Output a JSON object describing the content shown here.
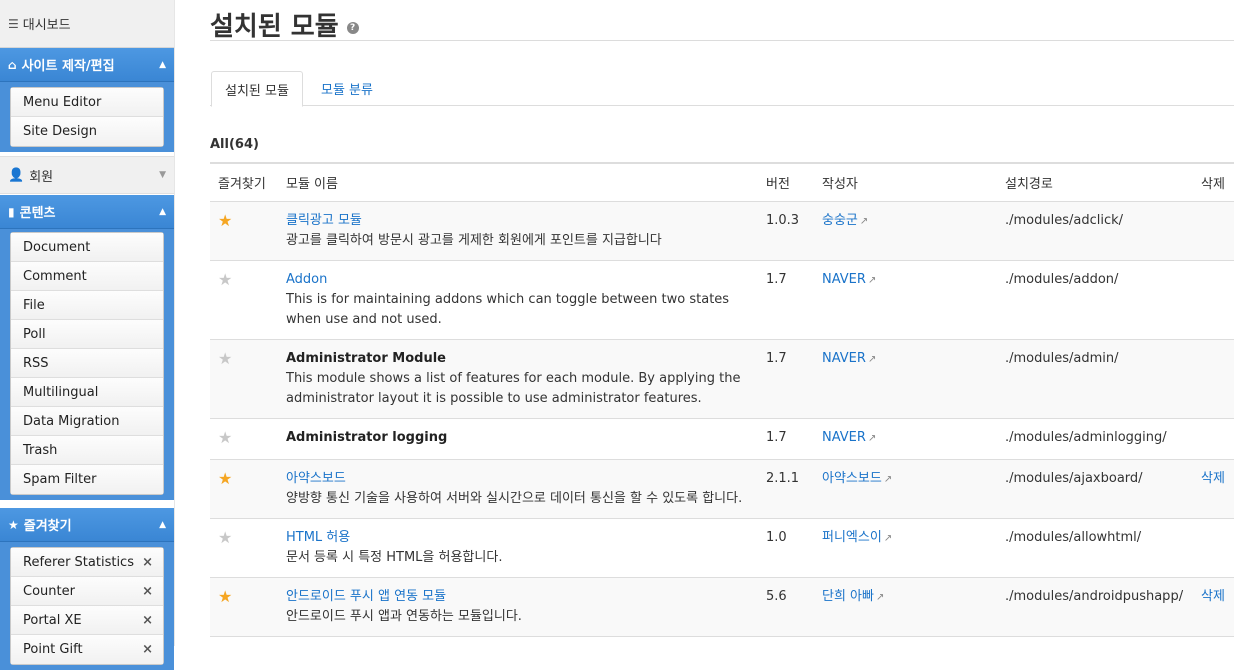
{
  "sidebar": {
    "dashboard": "대시보드",
    "site_group": {
      "title": "사이트 제작/편집",
      "items": [
        "Menu Editor",
        "Site Design"
      ]
    },
    "member_group": {
      "title": "회원"
    },
    "content_group": {
      "title": "콘텐츠",
      "items": [
        "Document",
        "Comment",
        "File",
        "Poll",
        "RSS",
        "Multilingual",
        "Data Migration",
        "Trash",
        "Spam Filter"
      ]
    },
    "fav_group": {
      "title": "즐겨찾기",
      "items": [
        "Referer Statistics",
        "Counter",
        "Portal XE",
        "Point Gift"
      ],
      "remove_symbol": "×"
    }
  },
  "page": {
    "title": "설치된 모듈",
    "help": "?",
    "tabs": [
      "설치된 모듈",
      "모듈 분류"
    ],
    "count_label": "All(64)"
  },
  "table": {
    "headers": [
      "즐겨찾기",
      "모듈 이름",
      "버전",
      "작성자",
      "설치경로",
      "삭제"
    ],
    "rows": [
      {
        "fav": true,
        "name": "클릭광고 모듈",
        "name_style": "link",
        "desc": "광고를 클릭하여 방문시 광고를 게제한 회원에게 포인트를 지급합니다",
        "version": "1.0.3",
        "author": "숭숭군",
        "path": "./modules/adclick/",
        "delete": ""
      },
      {
        "fav": false,
        "name": "Addon",
        "name_style": "link",
        "desc": "This is for maintaining addons which can toggle between two states when use and not used.",
        "version": "1.7",
        "author": "NAVER",
        "path": "./modules/addon/",
        "delete": ""
      },
      {
        "fav": false,
        "name": "Administrator Module",
        "name_style": "bold",
        "desc": "This module shows a list of features for each module. By applying the administrator layout it is possible to use administrator features.",
        "version": "1.7",
        "author": "NAVER",
        "path": "./modules/admin/",
        "delete": ""
      },
      {
        "fav": false,
        "name": "Administrator logging",
        "name_style": "bold",
        "desc": "",
        "version": "1.7",
        "author": "NAVER",
        "path": "./modules/adminlogging/",
        "delete": ""
      },
      {
        "fav": true,
        "name": "아약스보드",
        "name_style": "link",
        "desc": "양방향 통신 기술을 사용하여 서버와 실시간으로 데이터 통신을 할 수 있도록 합니다.",
        "version": "2.1.1",
        "author": "아약스보드",
        "path": "./modules/ajaxboard/",
        "delete": "삭제"
      },
      {
        "fav": false,
        "name": "HTML 허용",
        "name_style": "link",
        "desc": "문서 등록 시 특정 HTML을 허용합니다.",
        "version": "1.0",
        "author": "퍼니엑스이",
        "path": "./modules/allowhtml/",
        "delete": ""
      },
      {
        "fav": true,
        "name": "안드로이드 푸시 앱 연동 모듈",
        "name_style": "link",
        "desc": "안드로이드 푸시 앱과 연동하는 모듈입니다.",
        "version": "5.6",
        "author": "단희 아빠",
        "path": "./modules/androidpushapp/",
        "delete": "삭제"
      }
    ]
  },
  "icons": {
    "dashboard": "list-icon",
    "site": "home-icon",
    "member": "user-icon",
    "content": "document-icon",
    "favorites": "star-icon",
    "external": "external-link-icon"
  },
  "colors": {
    "sidebar_blue": "#3a86d4",
    "link": "#1a73c9",
    "star_on": "#f5a623",
    "star_off": "#c8c8c8"
  }
}
